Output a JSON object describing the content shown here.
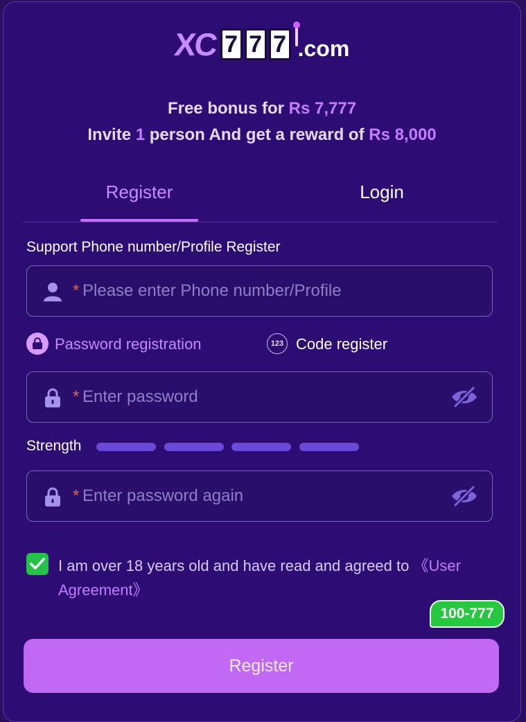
{
  "brand": {
    "logo_prefix": "XC",
    "logo_digits": [
      "7",
      "7",
      "7"
    ],
    "logo_suffix": ".com"
  },
  "promo": {
    "line1_text": "Free bonus for ",
    "line1_amount": "Rs 7,777",
    "line2_text_a": "Invite ",
    "line2_count": "1",
    "line2_text_b": " person And get a reward of ",
    "line2_amount": "Rs 8,000"
  },
  "tabs": [
    {
      "label": "Register",
      "active": true
    },
    {
      "label": "Login",
      "active": false
    }
  ],
  "form": {
    "phone_label": "Support Phone number/Profile Register",
    "required_mark": "*",
    "phone_placeholder": "Please enter Phone number/Profile",
    "mode_password_label": "Password registration",
    "mode_code_icon_text": "123",
    "mode_code_label": "Code register",
    "password_placeholder": "Enter password",
    "strength_label": "Strength",
    "strength_level": 0,
    "strength_segments": 4,
    "password_again_placeholder": "Enter password again",
    "agree_checked": true,
    "agree_text": "I am over 18 years old and have read and agreed to ",
    "agree_link": "《User Agreement》",
    "submit_label": "Register"
  },
  "badge": {
    "label": "100-777"
  },
  "colors": {
    "background": "#2d0d74",
    "accent": "#c168f4",
    "highlight": "#c67cff",
    "success": "#25c24a",
    "required": "#e06a4a"
  },
  "icons": {
    "user": "user-icon",
    "lock": "lock-icon",
    "eye_off": "eye-off-icon",
    "check": "check-icon",
    "code": "code-123-icon"
  }
}
